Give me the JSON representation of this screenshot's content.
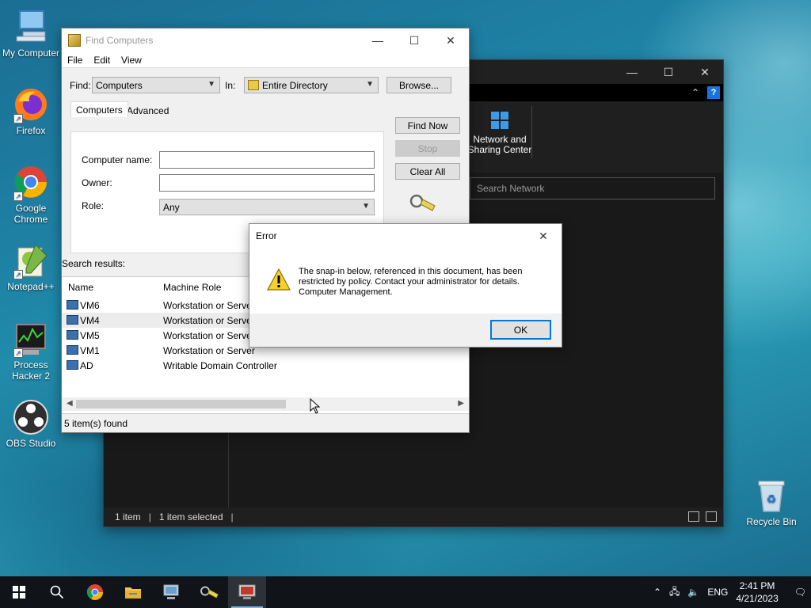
{
  "desktop": {
    "icons": [
      {
        "label": "My Computer"
      },
      {
        "label": "Firefox"
      },
      {
        "label": "Google Chrome"
      },
      {
        "label": "Notepad++"
      },
      {
        "label": "Process Hacker 2"
      },
      {
        "label": "OBS Studio"
      },
      {
        "label": "Recycle Bin"
      }
    ]
  },
  "explorer": {
    "ribbon_item": "Network and\nSharing Center",
    "search_placeholder": "Search Network",
    "status_items": "1 item",
    "status_selected": "1 item selected",
    "help": "?"
  },
  "find": {
    "title": "Find Computers",
    "menu": [
      "File",
      "Edit",
      "View"
    ],
    "find_label": "Find:",
    "find_value": "Computers",
    "in_label": "In:",
    "in_value": "Entire Directory",
    "browse": "Browse...",
    "tabs": [
      "Computers",
      "Advanced"
    ],
    "fields": {
      "computer_name": "Computer name:",
      "owner": "Owner:",
      "role": "Role:",
      "role_value": "Any"
    },
    "buttons": {
      "find_now": "Find Now",
      "stop": "Stop",
      "clear_all": "Clear All"
    },
    "search_results_label": "Search results:",
    "columns": [
      "Name",
      "Machine Role"
    ],
    "rows": [
      {
        "name": "VM6",
        "role": "Workstation or Server"
      },
      {
        "name": "VM4",
        "role": "Workstation or Server"
      },
      {
        "name": "VM5",
        "role": "Workstation or Server"
      },
      {
        "name": "VM1",
        "role": "Workstation or Server"
      },
      {
        "name": "AD",
        "role": "Writable Domain Controller"
      }
    ],
    "status": "5 item(s) found"
  },
  "error": {
    "title": "Error",
    "line1": "The snap-in below, referenced in this document, has been",
    "line2": "restricted by policy. Contact your administrator for details.",
    "line3": "Computer Management.",
    "ok": "OK"
  },
  "taskbar": {
    "lang": "ENG",
    "time": "2:41 PM",
    "date": "4/21/2023"
  },
  "colors": {
    "accent": "#0078d7",
    "taskbar": "#101418",
    "explorer_bg": "#191919"
  }
}
